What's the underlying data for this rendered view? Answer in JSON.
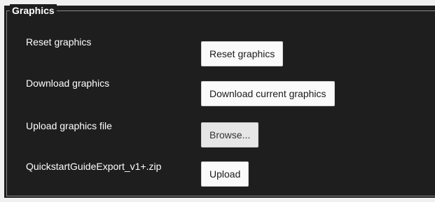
{
  "group": {
    "title": "Graphics"
  },
  "rows": [
    {
      "label": "Reset graphics",
      "button": "Reset graphics"
    },
    {
      "label": "Download graphics",
      "button": "Download current graphics"
    },
    {
      "label": "Upload graphics file",
      "button": "Browse..."
    },
    {
      "label": "QuickstartGuideExport_v1+.zip",
      "button": "Upload"
    }
  ],
  "colors": {
    "panel_background": "#1e1e1e",
    "text": "#ffffff",
    "button_background": "#fafafa",
    "browse_button_background": "#e6e6e6",
    "group_border": "#8a8a8a"
  }
}
